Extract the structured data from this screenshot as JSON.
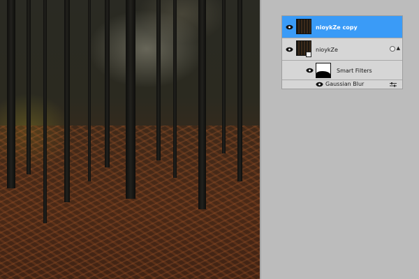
{
  "layers_panel": {
    "layers": [
      {
        "name": "nioykZe copy",
        "selected": true,
        "visible": true
      },
      {
        "name": "nioykZe",
        "selected": false,
        "visible": true,
        "smart_object": true
      }
    ],
    "smart_filters_label": "Smart Filters",
    "filters": [
      {
        "name": "Gaussian Blur",
        "visible": true
      }
    ]
  },
  "colors": {
    "selection": "#3a9bf7",
    "panel_bg": "#d6d6d6",
    "workspace_bg": "#bcbcbc"
  }
}
